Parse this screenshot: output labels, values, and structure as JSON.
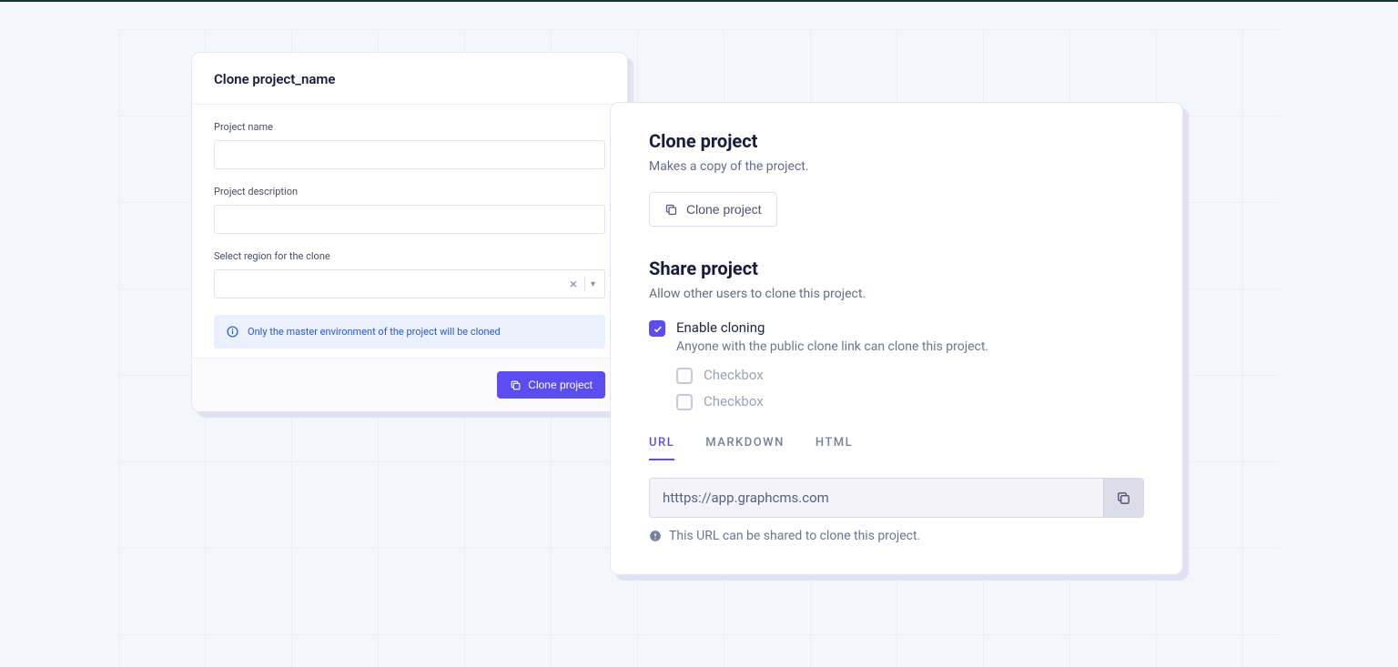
{
  "leftPanel": {
    "title": "Clone project_name",
    "fields": {
      "projectNameLabel": "Project name",
      "projectDescLabel": "Project description",
      "regionLabel": "Select region for the clone"
    },
    "infoBanner": "Only the master environment of the project will be cloned",
    "submitLabel": "Clone project"
  },
  "rightPanel": {
    "cloneTitle": "Clone project",
    "cloneSub": "Makes a copy of the project.",
    "cloneButton": "Clone project",
    "shareTitle": "Share project",
    "shareSub": "Allow other users to clone this project.",
    "enableCloning": {
      "label": "Enable cloning",
      "sub": "Anyone with the public clone link can clone this project."
    },
    "nestedOptions": [
      "Checkbox",
      "Checkbox"
    ],
    "tabs": [
      "URL",
      "MARKDOWN",
      "HTML"
    ],
    "activeTab": 0,
    "urlValue": "htttps://app.graphcms.com",
    "urlHint": "This URL can be shared to clone this project."
  }
}
